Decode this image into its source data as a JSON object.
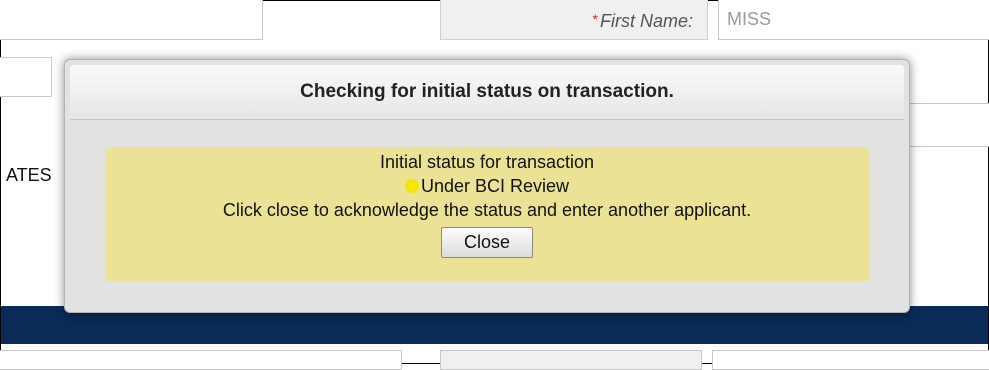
{
  "form": {
    "first_name_label": "First Name:",
    "required_marker": "*",
    "first_name_value": "MISS",
    "state_partial_text": "ATES"
  },
  "modal": {
    "title": "Checking for initial status on transaction.",
    "message_line1": "Initial status for transaction",
    "status_text": "Under BCI Review",
    "message_line3": "Click close to acknowledge the status and enter another applicant.",
    "close_label": "Close"
  },
  "colors": {
    "navbar": "#0a2a57",
    "message_panel": "#ece295",
    "status_dot": "#f3e600",
    "required_marker": "#e0202a"
  }
}
